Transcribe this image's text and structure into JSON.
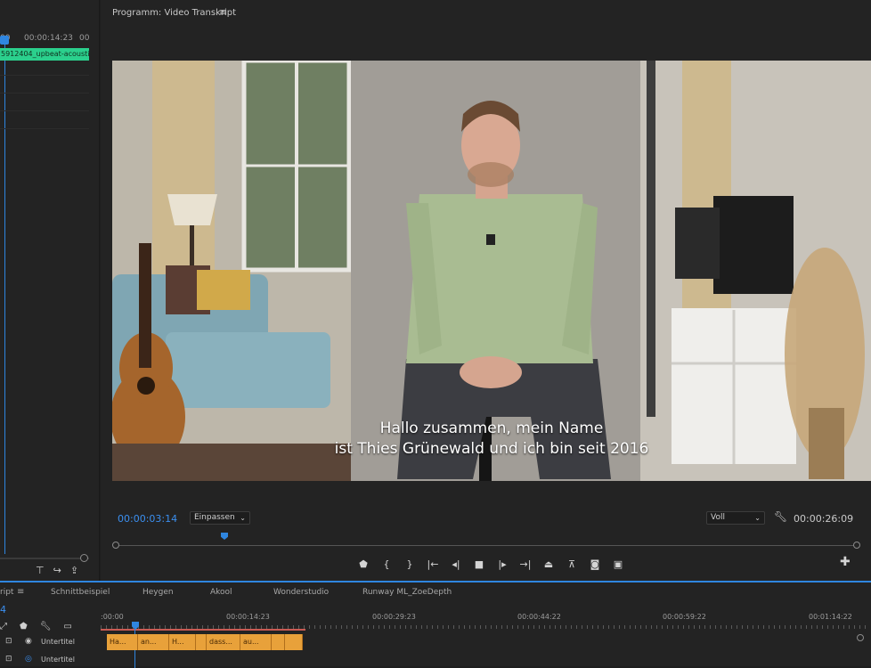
{
  "left_panel": {
    "ruler": [
      "00",
      "00:00:14:23",
      "00"
    ],
    "clip_label": "5912404_upbeat-acoustic"
  },
  "program": {
    "title": "Programm: Video Transkript",
    "subtitle_line1": "Hallo zusammen, mein Name",
    "subtitle_line2": "ist Thies Grünewald und ich bin seit 2016",
    "timecode_current": "00:00:03:14",
    "fit_value": "Einpassen",
    "quality_value": "Voll",
    "timecode_duration": "00:00:26:09",
    "accent_color": "#2f86e0"
  },
  "transport": {
    "buttons": [
      "marker-icon",
      "mark-in-icon",
      "mark-out-icon",
      "go-to-in-icon",
      "step-back-icon",
      "stop-icon",
      "step-forward-icon",
      "go-to-out-icon",
      "lift-icon",
      "extract-icon",
      "camera-icon",
      "compare-icon"
    ]
  },
  "timeline": {
    "tab_partial": "ript",
    "tabs": [
      "Schnittbeispiel",
      "Heygen",
      "Akool",
      "Wonderstudio",
      "Runway ML_ZoeDepth"
    ],
    "timecode_partial": "4",
    "ruler": [
      ":00:00",
      "00:00:14:23",
      "00:00:29:23",
      "00:00:44:22",
      "00:00:59:22",
      "00:01:14:22"
    ],
    "tracks": [
      {
        "name": "Untertitel"
      },
      {
        "name": "Untertitel"
      }
    ],
    "captions": [
      {
        "label": "Ha..."
      },
      {
        "label": "an..."
      },
      {
        "label": "H..."
      },
      {
        "label": ""
      },
      {
        "label": "dass..."
      },
      {
        "label": "au..."
      },
      {
        "label": ""
      },
      {
        "label": ""
      }
    ]
  }
}
